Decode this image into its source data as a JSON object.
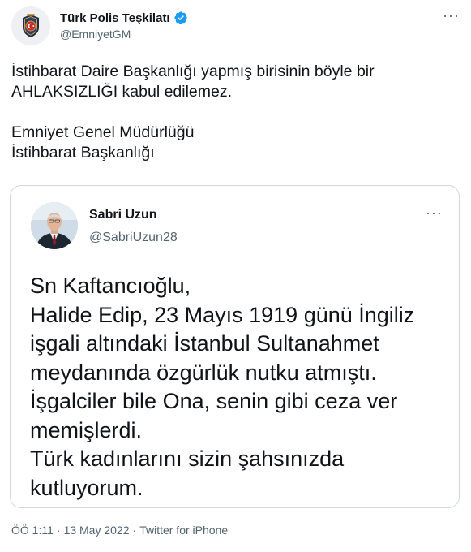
{
  "tweet": {
    "author": {
      "name": "Türk Polis Teşkilatı",
      "handle": "@EmniyetGM",
      "verified": true
    },
    "more_label": "···",
    "text_lines": [
      "İstihbarat Daire Başkanlığı yapmış birisinin böyle bir",
      "AHLAKSIZLIĞI kabul edilemez.",
      "Emniyet Genel Müdürlüğü",
      "İstihbarat Başkanlığı"
    ],
    "footer": {
      "time": "ÖÖ 1:11",
      "separator": "·",
      "date": "13 May 2022",
      "source": "Twitter for iPhone"
    }
  },
  "quoted_tweet": {
    "author": {
      "name": "Sabri Uzun",
      "handle": "@SabriUzun28"
    },
    "more_label": "···",
    "text_lines": [
      "Sn Kaftancıoğlu,",
      "Halide Edip, 23 Mayıs 1919 günü İngiliz",
      "işgali altındaki İstanbul Sultanahmet",
      "meydanında özgürlük nutku atmıştı.",
      "İşgalciler bile Ona, senin gibi ceza ver",
      "memişlerdi.",
      "Türk kadınlarını sizin şahsınızda",
      "kutluyorum."
    ]
  },
  "colors": {
    "text": "#0f1419",
    "secondary": "#536471",
    "verified_blue": "#1d9bf0",
    "border": "#cfd9de"
  },
  "icons": {
    "main_avatar": "police-emblem-icon",
    "verified": "verified-badge-icon",
    "more": "more-options-icon"
  }
}
